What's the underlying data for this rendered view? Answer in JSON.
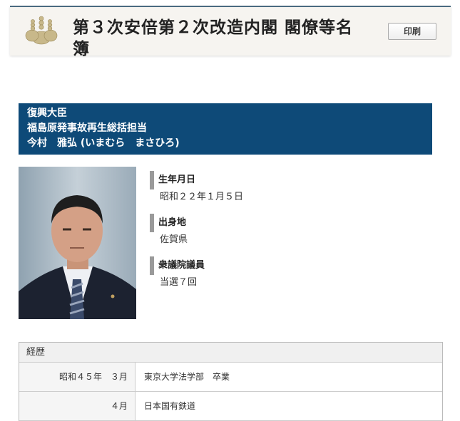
{
  "header": {
    "title": "第３次安倍第２次改造内閣 閣僚等名簿",
    "print_label": "印刷"
  },
  "role": {
    "line1": "復興大臣",
    "line2": "福島原発事故再生総括担当",
    "line3": "今村　雅弘 (いまむら　まさひろ)"
  },
  "profile": {
    "birth_label": "生年月日",
    "birth_value": "昭和２２年１月５日",
    "origin_label": "出身地",
    "origin_value": "佐賀県",
    "house_label": "衆議院議員",
    "house_value": "当選７回"
  },
  "career": {
    "header": "経歴",
    "rows": [
      {
        "date": "昭和４５年　３月",
        "desc": "東京大学法学部　卒業"
      },
      {
        "date": "４月",
        "desc": "日本国有鉄道"
      }
    ]
  },
  "colors": {
    "banner": "#0e4a78",
    "header_border": "#4a6a80"
  }
}
